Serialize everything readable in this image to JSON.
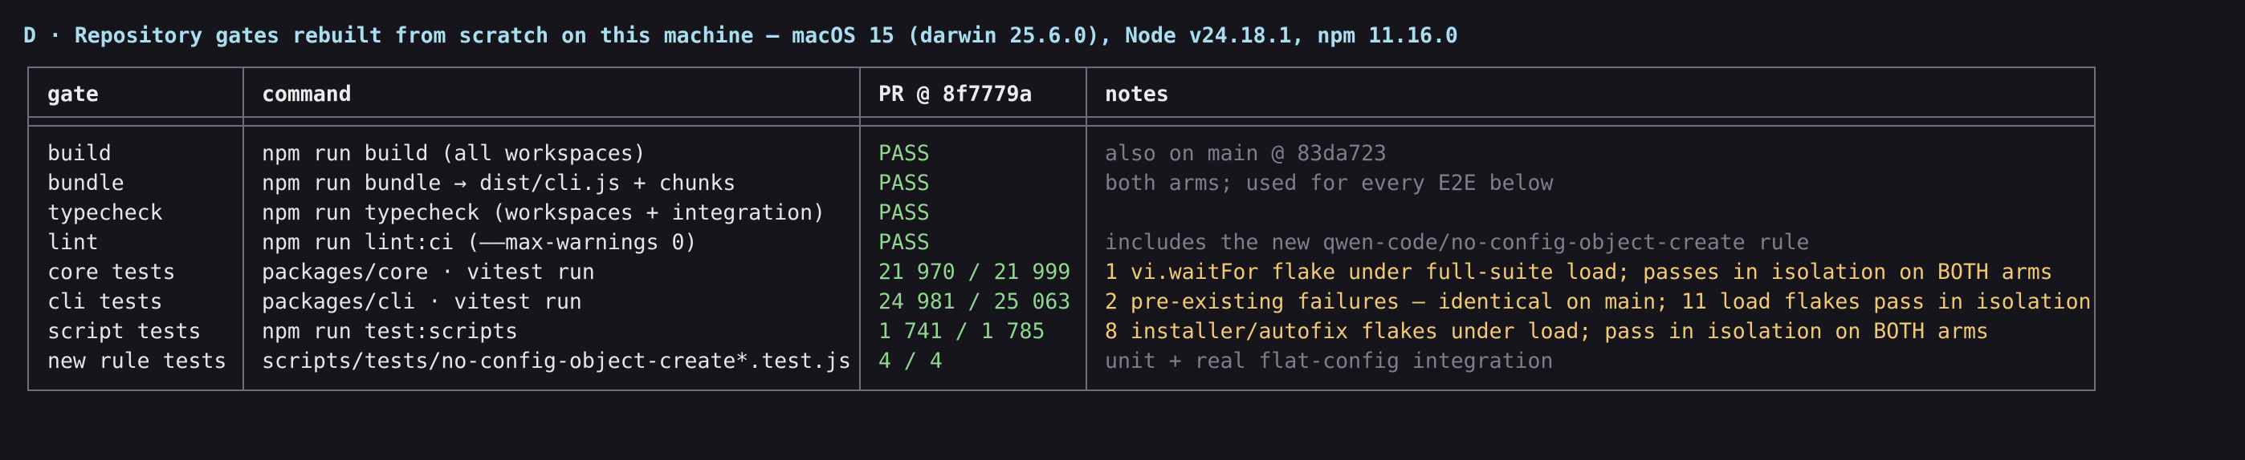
{
  "heading": "D · Repository gates rebuilt from scratch on this machine — macOS 15 (darwin 25.6.0), Node v24.18.1, npm 11.16.0",
  "columns": [
    "gate",
    "command",
    "PR @ 8f7779a",
    "notes"
  ],
  "rows": [
    {
      "gate": "build",
      "command": "npm run build (all workspaces)",
      "result": "PASS",
      "notes": "also on main @ 83da723",
      "notes_tone": "muted"
    },
    {
      "gate": "bundle",
      "command": "npm run bundle → dist/cli.js + chunks",
      "result": "PASS",
      "notes": "both arms; used for every E2E below",
      "notes_tone": "muted"
    },
    {
      "gate": "typecheck",
      "command": "npm run typecheck (workspaces + integration)",
      "result": "PASS",
      "notes": "",
      "notes_tone": "muted"
    },
    {
      "gate": "lint",
      "command": "npm run lint:ci (––max-warnings 0)",
      "result": "PASS",
      "notes": "includes the new qwen-code/no-config-object-create rule",
      "notes_tone": "muted"
    },
    {
      "gate": "core tests",
      "command": "packages/core · vitest run",
      "result": "21 970 / 21 999",
      "notes": "1 vi.waitFor flake under full-suite load; passes in isolation on BOTH arms",
      "notes_tone": "warn"
    },
    {
      "gate": "cli tests",
      "command": "packages/cli · vitest run",
      "result": "24 981 / 25 063",
      "notes": "2 pre-existing failures — identical on main; 11 load flakes pass in isolation",
      "notes_tone": "warn"
    },
    {
      "gate": "script tests",
      "command": "npm run test:scripts",
      "result": "1 741 / 1 785",
      "notes": "8 installer/autofix flakes under load; pass in isolation on BOTH arms",
      "notes_tone": "warn"
    },
    {
      "gate": "new rule tests",
      "command": "scripts/tests/no-config-object-create*.test.js",
      "result": "4 / 4",
      "notes": "unit + real flat-config integration",
      "notes_tone": "muted"
    }
  ],
  "colors": {
    "background": "#15151b",
    "heading": "#a9ddf2",
    "border": "#6b6e7b",
    "pass": "#8fd68f",
    "muted": "#7b7f8b",
    "warn": "#f2c972",
    "text": "#e6e6e6"
  }
}
